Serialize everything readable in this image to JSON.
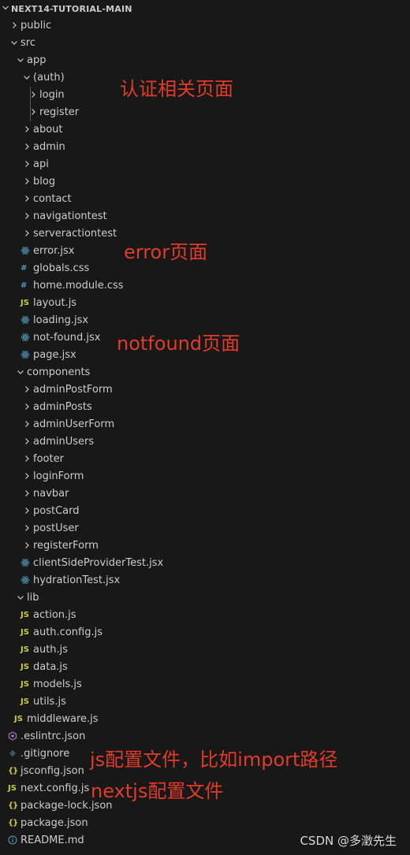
{
  "explorer": {
    "title": "NEXT14-TUTORIAL-MAIN",
    "items": [
      {
        "label": "public",
        "kind": "folder",
        "expanded": false,
        "icon": "chevron-right-icon"
      },
      {
        "label": "src",
        "kind": "folder",
        "expanded": true,
        "icon": "chevron-down-icon"
      },
      {
        "label": "app",
        "kind": "folder",
        "expanded": true,
        "icon": "chevron-down-icon"
      },
      {
        "label": "(auth)",
        "kind": "folder",
        "expanded": true,
        "icon": "chevron-down-icon"
      },
      {
        "label": "login",
        "kind": "folder",
        "expanded": false,
        "icon": "chevron-right-icon"
      },
      {
        "label": "register",
        "kind": "folder",
        "expanded": false,
        "icon": "chevron-right-icon"
      },
      {
        "label": "about",
        "kind": "folder",
        "expanded": false,
        "icon": "chevron-right-icon"
      },
      {
        "label": "admin",
        "kind": "folder",
        "expanded": false,
        "icon": "chevron-right-icon"
      },
      {
        "label": "api",
        "kind": "folder",
        "expanded": false,
        "icon": "chevron-right-icon"
      },
      {
        "label": "blog",
        "kind": "folder",
        "expanded": false,
        "icon": "chevron-right-icon"
      },
      {
        "label": "contact",
        "kind": "folder",
        "expanded": false,
        "icon": "chevron-right-icon"
      },
      {
        "label": "navigationtest",
        "kind": "folder",
        "expanded": false,
        "icon": "chevron-right-icon"
      },
      {
        "label": "serveractiontest",
        "kind": "folder",
        "expanded": false,
        "icon": "chevron-right-icon"
      },
      {
        "label": "error.jsx",
        "kind": "file",
        "icon": "react-icon"
      },
      {
        "label": "globals.css",
        "kind": "file",
        "icon": "css-icon"
      },
      {
        "label": "home.module.css",
        "kind": "file",
        "icon": "css-icon"
      },
      {
        "label": "layout.js",
        "kind": "file",
        "icon": "js-icon"
      },
      {
        "label": "loading.jsx",
        "kind": "file",
        "icon": "react-icon"
      },
      {
        "label": "not-found.jsx",
        "kind": "file",
        "icon": "react-icon"
      },
      {
        "label": "page.jsx",
        "kind": "file",
        "icon": "react-icon"
      },
      {
        "label": "components",
        "kind": "folder",
        "expanded": true,
        "icon": "chevron-down-icon"
      },
      {
        "label": "adminPostForm",
        "kind": "folder",
        "expanded": false,
        "icon": "chevron-right-icon"
      },
      {
        "label": "adminPosts",
        "kind": "folder",
        "expanded": false,
        "icon": "chevron-right-icon"
      },
      {
        "label": "adminUserForm",
        "kind": "folder",
        "expanded": false,
        "icon": "chevron-right-icon"
      },
      {
        "label": "adminUsers",
        "kind": "folder",
        "expanded": false,
        "icon": "chevron-right-icon"
      },
      {
        "label": "footer",
        "kind": "folder",
        "expanded": false,
        "icon": "chevron-right-icon"
      },
      {
        "label": "loginForm",
        "kind": "folder",
        "expanded": false,
        "icon": "chevron-right-icon"
      },
      {
        "label": "navbar",
        "kind": "folder",
        "expanded": false,
        "icon": "chevron-right-icon"
      },
      {
        "label": "postCard",
        "kind": "folder",
        "expanded": false,
        "icon": "chevron-right-icon"
      },
      {
        "label": "postUser",
        "kind": "folder",
        "expanded": false,
        "icon": "chevron-right-icon"
      },
      {
        "label": "registerForm",
        "kind": "folder",
        "expanded": false,
        "icon": "chevron-right-icon"
      },
      {
        "label": "clientSideProviderTest.jsx",
        "kind": "file",
        "icon": "react-icon"
      },
      {
        "label": "hydrationTest.jsx",
        "kind": "file",
        "icon": "react-icon"
      },
      {
        "label": "lib",
        "kind": "folder",
        "expanded": true,
        "icon": "chevron-down-icon"
      },
      {
        "label": "action.js",
        "kind": "file",
        "icon": "js-icon"
      },
      {
        "label": "auth.config.js",
        "kind": "file",
        "icon": "js-icon"
      },
      {
        "label": "auth.js",
        "kind": "file",
        "icon": "js-icon"
      },
      {
        "label": "data.js",
        "kind": "file",
        "icon": "js-icon"
      },
      {
        "label": "models.js",
        "kind": "file",
        "icon": "js-icon"
      },
      {
        "label": "utils.js",
        "kind": "file",
        "icon": "js-icon"
      },
      {
        "label": "middleware.js",
        "kind": "file",
        "icon": "js-icon"
      },
      {
        "label": ".eslintrc.json",
        "kind": "file",
        "icon": "eslint-icon"
      },
      {
        "label": ".gitignore",
        "kind": "file",
        "icon": "git-icon"
      },
      {
        "label": "jsconfig.json",
        "kind": "file",
        "icon": "json-icon"
      },
      {
        "label": "next.config.js",
        "kind": "file",
        "icon": "js-icon"
      },
      {
        "label": "package-lock.json",
        "kind": "file",
        "icon": "json-icon"
      },
      {
        "label": "package.json",
        "kind": "file",
        "icon": "json-icon"
      },
      {
        "label": "README.md",
        "kind": "file",
        "icon": "info-icon"
      }
    ]
  },
  "icons": {
    "js": "JS",
    "css": "#",
    "json": "{}"
  },
  "annotations": {
    "auth": "认证相关页面",
    "error": "error页面",
    "notfound": "notfound页面",
    "jsconfig": "js配置文件，比如import路径",
    "nextconfig": "nextjs配置文件"
  },
  "watermark": "CSDN @多澂先生",
  "colors": {
    "background": "#181818",
    "text": "#cccccc",
    "annotation": "#e03c2a",
    "js_icon": "#cbcb41",
    "css_icon": "#519aba",
    "react_icon": "#519aba",
    "eslint_icon": "#a074c4",
    "git_icon": "#41535b",
    "info_icon": "#519aba"
  }
}
